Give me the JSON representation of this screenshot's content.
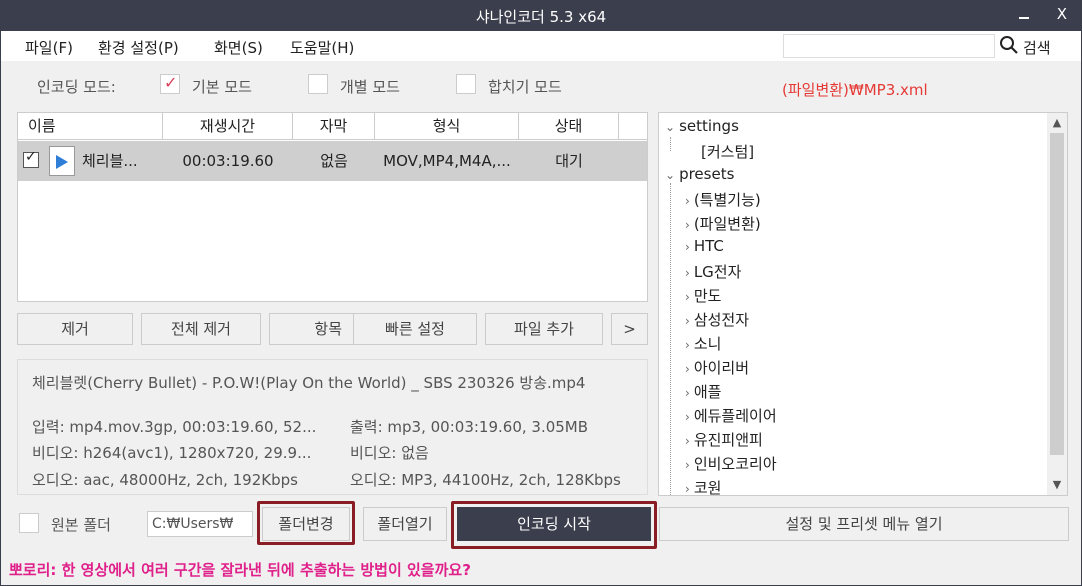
{
  "window": {
    "title": "샤나인코더  5.3  x64",
    "close_label": "X"
  },
  "menu": {
    "items": [
      "파일(F)",
      "환경 설정(P)",
      "화면(S)",
      "도움말(H)"
    ],
    "search_placeholder": "",
    "search_label": "검색"
  },
  "mode": {
    "label": "인코딩 모드:",
    "options": [
      {
        "label": "기본 모드",
        "checked": true
      },
      {
        "label": "개별 모드",
        "checked": false
      },
      {
        "label": "합치기 모드",
        "checked": false
      }
    ]
  },
  "preset_path": "(파일변환)₩MP3.xml",
  "file_list": {
    "columns": [
      "이름",
      "재생시간",
      "자막",
      "형식",
      "상태"
    ],
    "rows": [
      {
        "checked": true,
        "name": "체리블...",
        "duration": "00:03:19.60",
        "subtitle": "없음",
        "format": "MOV,MP4,M4A,...",
        "status": "대기"
      }
    ]
  },
  "list_buttons": [
    "제거",
    "전체 제거",
    "항목",
    "빠른 설정",
    "파일 추가",
    ">"
  ],
  "info": {
    "filename": "체리블렛(Cherry Bullet) - P.O.W!(Play On the World) _ SBS 230326 방송.mp4",
    "input": "입력: mp4.mov.3gp, 00:03:19.60, 52...",
    "input_video": "비디오: h264(avc1), 1280x720, 29.9...",
    "input_audio": "오디오: aac, 48000Hz, 2ch, 192Kbps",
    "output": "출력: mp3, 00:03:19.60, 3.05MB",
    "output_video": "비디오: 없음",
    "output_audio": "오디오: MP3, 44100Hz, 2ch, 128Kbps"
  },
  "tree": {
    "root1": "settings",
    "root1_child": "[커스텀]",
    "root2": "presets",
    "presets": [
      "(특별기능)",
      "(파일변환)",
      "HTC",
      "LG전자",
      "만도",
      "삼성전자",
      "소니",
      "아이리버",
      "애플",
      "에듀플레이어",
      "유진피앤피",
      "인비오코리아",
      "코원"
    ]
  },
  "bottom": {
    "original_folder_label": "원본 폴더",
    "original_folder_checked": false,
    "path_value": "C:₩Users₩",
    "change_folder": "폴더변경",
    "open_folder": "폴더열기",
    "start_encoding": "인코딩 시작",
    "settings_menu": "설정 및 프리셋 메뉴 열기"
  },
  "tip": "뽀로리: 한 영상에서 여러 구간을 잘라낸 뒤에 추출하는 방법이 있을까요?",
  "colors": {
    "titlebar": "#3b3e4c",
    "accent_red": "#e53935",
    "highlight_box": "#8a1c24",
    "tip": "#e0208a",
    "check": "#d9405a"
  }
}
